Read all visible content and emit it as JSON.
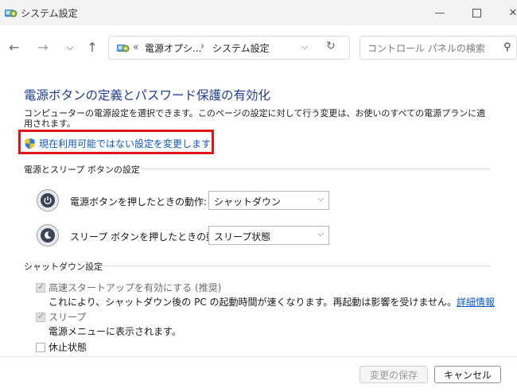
{
  "window": {
    "title": "システム設定",
    "min_glyph": "—",
    "close_glyph": "✕"
  },
  "nav": {
    "back_icon": "back-arrow-icon",
    "forward_icon": "forward-arrow-icon",
    "recent_icon": "chevron-down-icon",
    "up_icon": "up-arrow-icon",
    "breadcrumb_prefix": "«",
    "breadcrumbs": [
      "電源オプシ...",
      "システム設定"
    ],
    "breadcrumb_separator": "›",
    "search_placeholder": "コントロール パネルの検索"
  },
  "content": {
    "title": "電源ボタンの定義とパスワード保護の有効化",
    "description": "コンピューターの電源設定を選択できます。このページの設定に対して行う変更は、お使いのすべての電源プランに適用されます。",
    "uac_link": "現在利用可能ではない設定を変更します",
    "power_section": {
      "heading": "電源とスリープ ボタンの設定",
      "rows": [
        {
          "label": "電源ボタンを押したときの動作:",
          "value": "シャットダウン",
          "icon": "power-button-icon"
        },
        {
          "label": "スリープ ボタンを押したときの動作:",
          "value": "スリープ状態",
          "icon": "sleep-button-icon"
        }
      ]
    },
    "shutdown_section": {
      "heading": "シャットダウン設定",
      "fast_startup": {
        "label": "高速スタートアップを有効にする (推奨)",
        "checked": true,
        "description": "これにより、シャットダウン後の PC の起動時間が速くなります。再起動は影響を受けません。",
        "link": "詳細情報"
      },
      "sleep": {
        "label": "スリープ",
        "checked": true,
        "description": "電源メニューに表示されます。"
      },
      "hibernate": {
        "label": "休止状態",
        "checked": false
      }
    }
  },
  "footer": {
    "save_label": "変更の保存",
    "cancel_label": "キャンセル"
  },
  "colors": {
    "title_blue": "#1e3d8c",
    "link_blue": "#0b59c4",
    "highlight_red": "#e0141b"
  }
}
